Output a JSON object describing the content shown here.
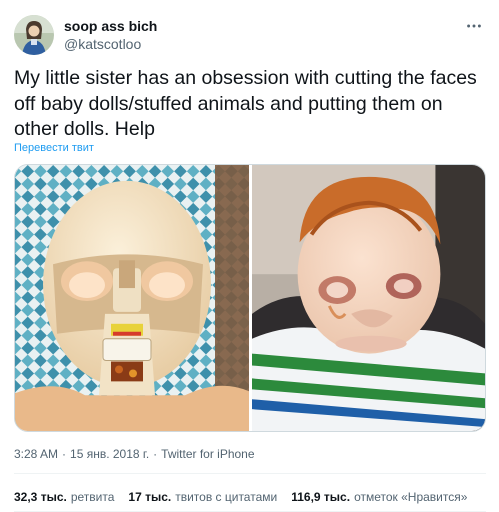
{
  "author": {
    "display_name": "soop ass bich",
    "handle": "@katscotloo",
    "avatar": "avatar-photo"
  },
  "more_icon": "more-horizontal-icon",
  "tweet": {
    "text": "My little sister has an obsession with cutting the faces off baby dolls/stuffed animals and putting them on other dolls. Help",
    "translate_label": "Перевести твит"
  },
  "media": {
    "photos": [
      "doll-without-face-photo",
      "baby-doll-with-face-photo"
    ]
  },
  "meta": {
    "time": "3:28 AM",
    "separator1": "·",
    "date": "15 янв. 2018 г.",
    "separator2": "·",
    "source": "Twitter for iPhone"
  },
  "stats": {
    "retweets_count": "32,3 тыс.",
    "retweets_label": "ретвита",
    "quotes_count": "17 тыс.",
    "quotes_label": "твитов с цитатами",
    "likes_count": "116,9 тыс.",
    "likes_label": "отметок «Нравится»"
  },
  "colors": {
    "text": "#0f1419",
    "secondary": "#536471",
    "link": "#1d9bf0",
    "border": "#cfd9de"
  }
}
